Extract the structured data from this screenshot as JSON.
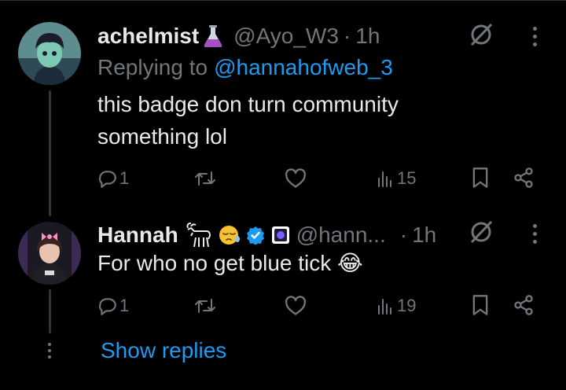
{
  "tweets": [
    {
      "display_name": "achelmist",
      "handle": "@Ayo_W3",
      "time": "1h",
      "reply_prefix": "Replying to",
      "reply_to": "@hannahofweb_3",
      "text_line1": "this badge don turn community",
      "text_line2": "something lol",
      "replies": "1",
      "retweets": "",
      "likes": "",
      "views": "15"
    },
    {
      "display_name": "Hannah",
      "handle": "@hann...",
      "time": "1h",
      "text": "For who no get blue tick 😂",
      "replies": "1",
      "retweets": "",
      "likes": "",
      "views": "19"
    }
  ],
  "show_replies": "Show replies",
  "colors": {
    "accent": "#1d9bf0",
    "muted": "#71767b",
    "text": "#e7e9ea",
    "background": "#000000"
  },
  "icons": [
    "alembic-icon",
    "goat-icon",
    "sleepy-face-icon",
    "verified-badge-icon",
    "affiliate-badge-icon",
    "grok-icon",
    "more-icon",
    "reply-icon",
    "retweet-icon",
    "like-icon",
    "views-icon",
    "bookmark-icon",
    "share-icon"
  ]
}
